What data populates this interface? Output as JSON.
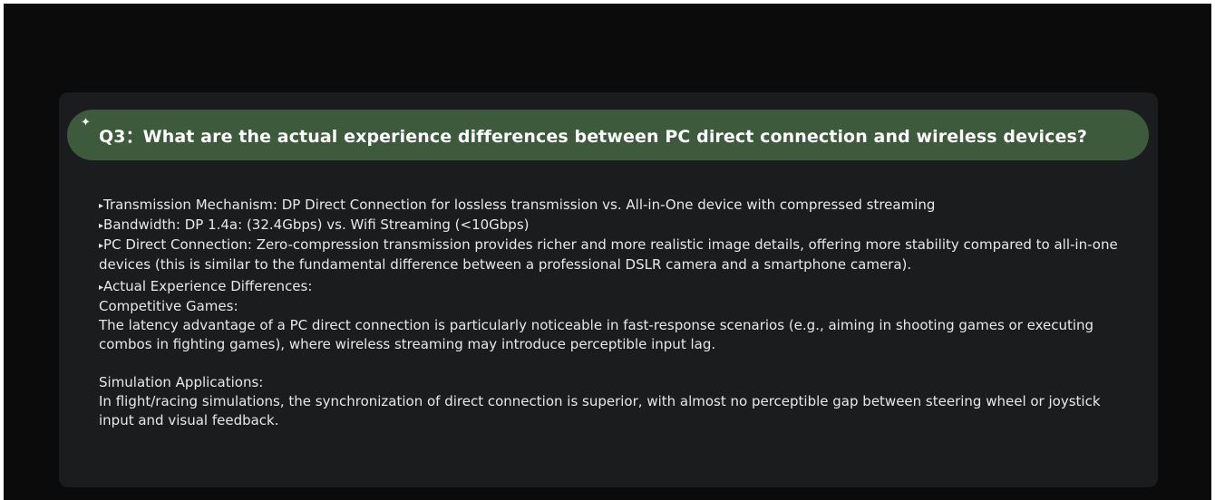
{
  "question": {
    "sparkle": "✦",
    "text": "Q3：What are the actual experience differences between PC direct connection and wireless devices?"
  },
  "answer": {
    "bullet": "▸",
    "transmission": "Transmission Mechanism: DP Direct Connection for lossless transmission vs. All-in-One device with compressed streaming",
    "bandwidth": "Bandwidth: DP 1.4a: (32.4Gbps) vs. Wifi Streaming (<10Gbps)",
    "pc_direct": "PC Direct Connection: Zero-compression transmission provides richer and more realistic image details, offering more stability compared to all-in-one devices (this is similar to the fundamental difference between a professional DSLR camera and a smartphone camera).",
    "actual_heading": "Actual Experience Differences:",
    "competitive_heading": "Competitive Games:",
    "competitive_text": "The latency advantage of a PC direct connection is particularly noticeable in fast-response scenarios (e.g., aiming in shooting games or executing combos in fighting games), where wireless streaming may introduce perceptible input lag.",
    "simulation_heading": "Simulation Applications:",
    "simulation_text": "In flight/racing simulations, the synchronization of direct connection is superior, with almost no perceptible gap between steering wheel or joystick input and visual feedback."
  }
}
